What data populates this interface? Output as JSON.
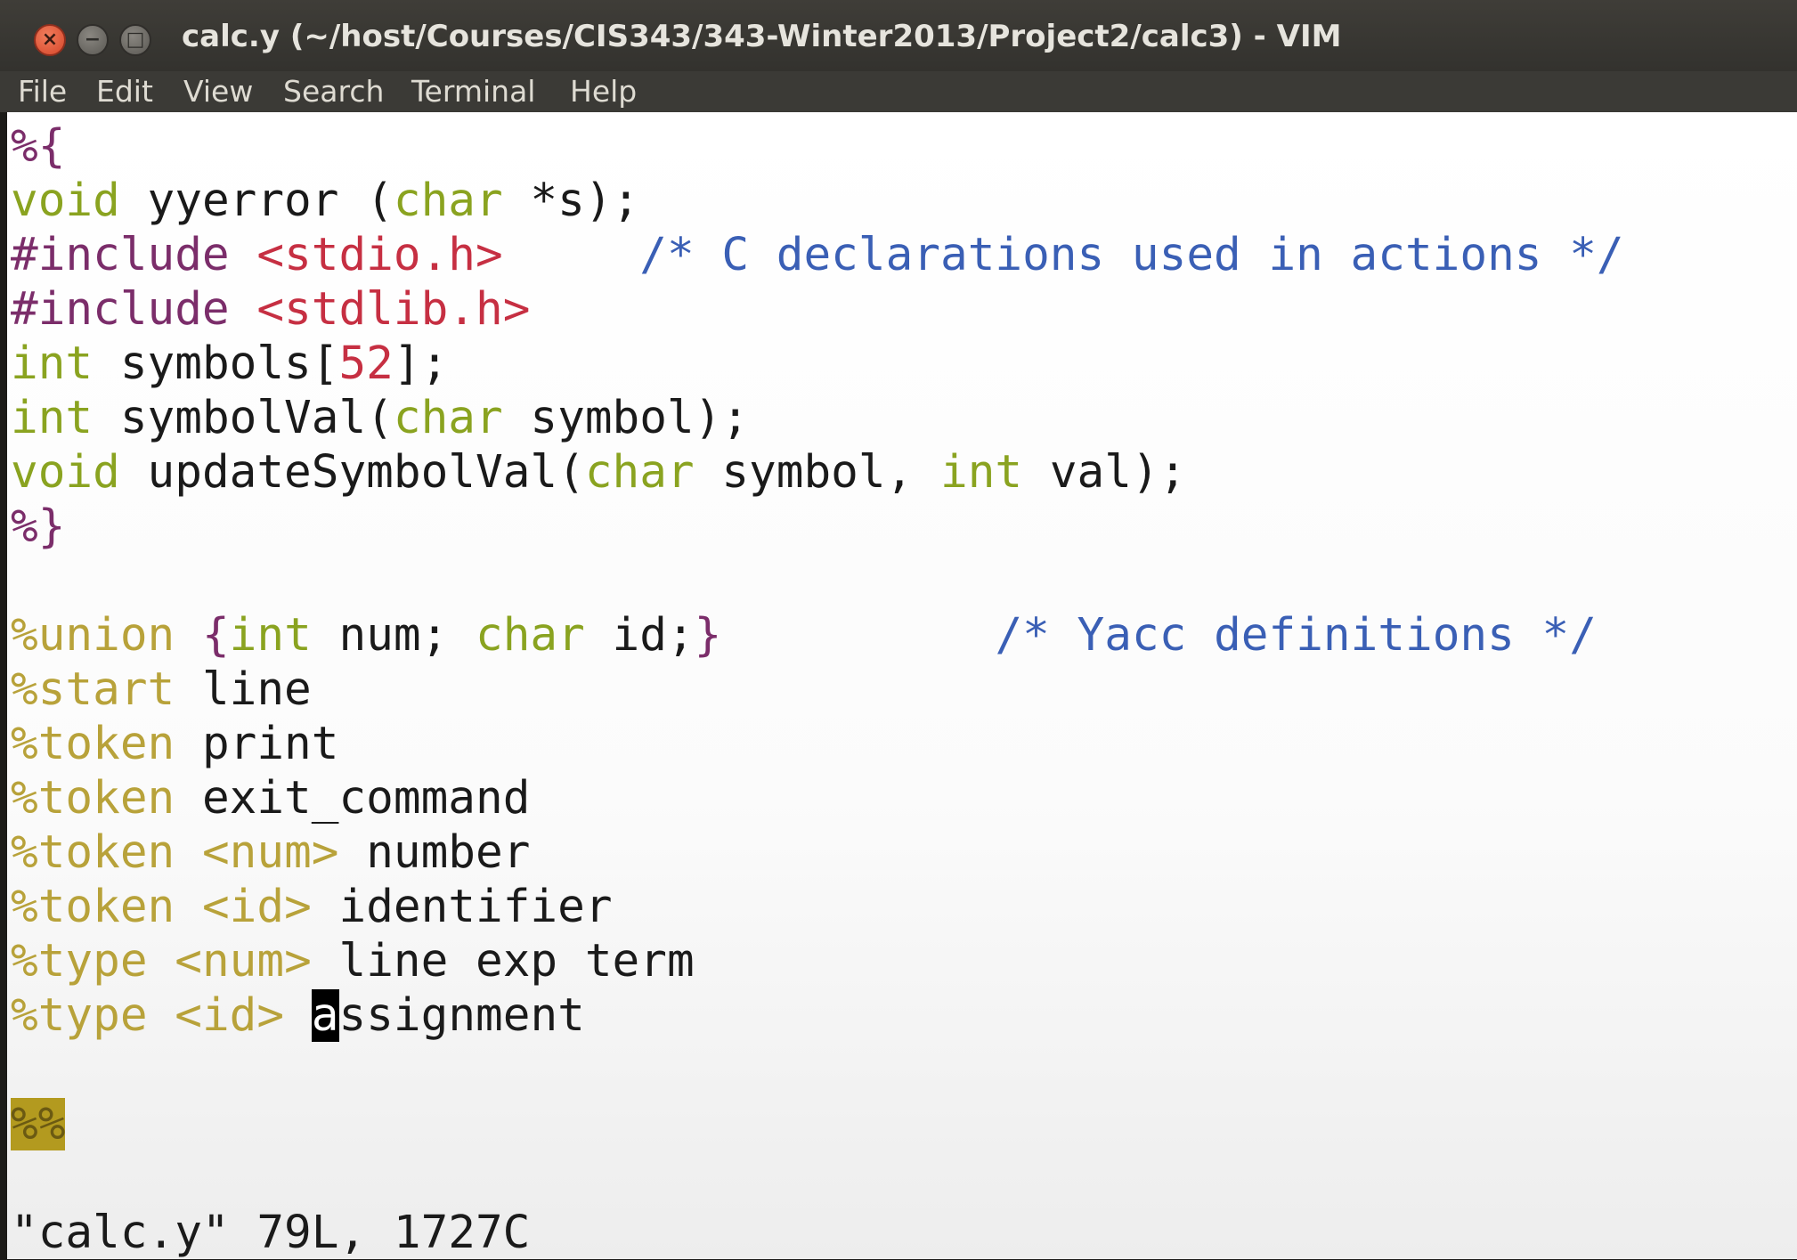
{
  "window": {
    "title": "calc.y (~/host/Courses/CIS343/343-Winter2013/Project2/calc3) - VIM",
    "close_glyph": "×",
    "minimize_glyph": "−",
    "maximize_glyph": "□"
  },
  "menu": [
    "File",
    "Edit",
    "View",
    "Search",
    "Terminal",
    "Help"
  ],
  "code": {
    "l1": [
      "%{"
    ],
    "l2": [
      "void",
      " yyerror (",
      "char",
      " *s);"
    ],
    "l3": [
      "#include",
      " ",
      "<stdio.h>",
      "     ",
      "/* C declarations used in actions */"
    ],
    "l4": [
      "#include",
      " ",
      "<stdlib.h>"
    ],
    "l5": [
      "int",
      " symbols[",
      "52",
      "];"
    ],
    "l6": [
      "int",
      " symbolVal(",
      "char",
      " symbol);"
    ],
    "l7": [
      "void",
      " updateSymbolVal(",
      "char",
      " symbol, ",
      "int",
      " val);"
    ],
    "l8": [
      "%}"
    ],
    "l9": [
      "%union",
      " {",
      "int",
      " num; ",
      "char",
      " id;",
      "}",
      "          ",
      "/* Yacc definitions */"
    ],
    "l10": [
      "%start",
      " line"
    ],
    "l11": [
      "%token",
      " print"
    ],
    "l12": [
      "%token",
      " exit_command"
    ],
    "l13": [
      "%token",
      " ",
      "<num>",
      " number"
    ],
    "l14": [
      "%token",
      " ",
      "<id>",
      " identifier"
    ],
    "l15": [
      "%type",
      " ",
      "<num>",
      " line exp term"
    ],
    "l16": [
      "%type",
      " ",
      "<id>",
      " ",
      "a",
      "ssignment"
    ],
    "l17": [
      "%%"
    ]
  },
  "status_message": "\"calc.y\" 79L, 1727C",
  "colors": {
    "keyword": "#8aa320",
    "preprocessor": "#7b2d6a",
    "string": "#c62f42",
    "comment": "#3a5fb5",
    "directive": "#b8a23a",
    "highlight": "#b39a1f"
  }
}
